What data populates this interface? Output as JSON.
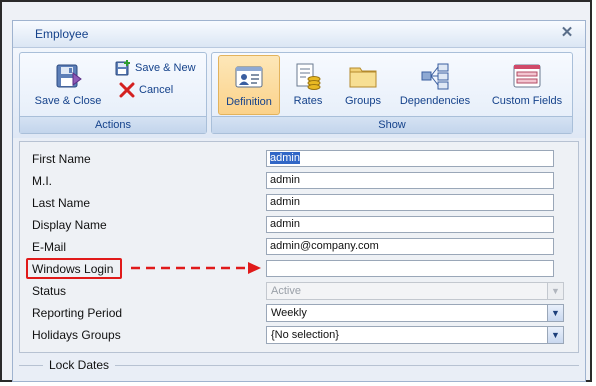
{
  "window": {
    "title": "Employee"
  },
  "ribbon": {
    "actions_group": {
      "label": "Actions",
      "save_close": "Save & Close",
      "save_new": "Save & New",
      "cancel": "Cancel"
    },
    "show_group": {
      "label": "Show",
      "items": [
        {
          "label": "Definition",
          "icon": "definition-icon",
          "active": true
        },
        {
          "label": "Rates",
          "icon": "rates-icon",
          "active": false
        },
        {
          "label": "Groups",
          "icon": "folder-icon",
          "active": false
        },
        {
          "label": "Dependencies",
          "icon": "dependencies-icon",
          "active": false
        },
        {
          "label": "Custom Fields",
          "icon": "custom-fields-icon",
          "active": false
        }
      ]
    }
  },
  "form": {
    "first_name": {
      "label": "First Name",
      "value": "admin"
    },
    "mi": {
      "label": "M.I.",
      "value": "admin"
    },
    "last_name": {
      "label": "Last Name",
      "value": "admin"
    },
    "display_name": {
      "label": "Display Name",
      "value": "admin"
    },
    "email": {
      "label": "E-Mail",
      "value": "admin@company.com"
    },
    "windows_login": {
      "label": "Windows Login",
      "value": ""
    },
    "status": {
      "label": "Status",
      "value": "Active"
    },
    "reporting_period": {
      "label": "Reporting Period",
      "value": "Weekly"
    },
    "holidays_groups": {
      "label": "Holidays Groups",
      "value": "{No selection}"
    }
  },
  "lock_dates": {
    "legend": "Lock Dates"
  },
  "colors": {
    "highlight": "#e01a1a",
    "accent": "#15428b",
    "active_tab": "#fbd28a"
  }
}
